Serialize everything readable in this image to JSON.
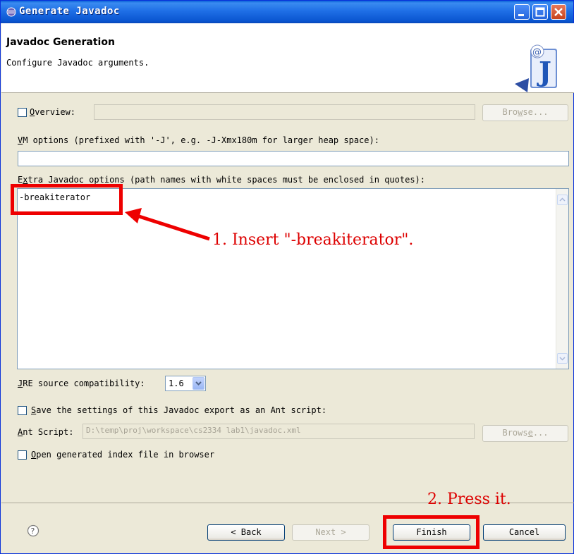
{
  "window": {
    "title": "Generate Javadoc",
    "controls": {
      "minimize": "minimize",
      "maximize": "maximize",
      "close": "close"
    }
  },
  "banner": {
    "title": "Javadoc Generation",
    "description": "Configure Javadoc arguments.",
    "icon": "javadoc-wizard-icon"
  },
  "overview": {
    "label": "Overview:",
    "mnemonic": "O",
    "value": "",
    "browse_label": "Browse...",
    "browse_mnemonic": "w"
  },
  "vm_options": {
    "label": "VM options (prefixed with '-J', e.g. -J-Xmx180m for larger heap space):",
    "mnemonic": "V",
    "value": ""
  },
  "extra_options": {
    "label": "Extra Javadoc options (path names with white spaces must be enclosed in quotes):",
    "mnemonic": "x",
    "value": "-breakiterator"
  },
  "jre": {
    "label": "JRE source compatibility:",
    "mnemonic": "J",
    "selected": "1.6"
  },
  "ant": {
    "save_label": "Save the settings of this Javadoc export as an Ant script:",
    "save_mnemonic": "S",
    "script_label": "Ant Script:",
    "script_mnemonic": "A",
    "script_value": "D:\\temp\\proj\\workspace\\cs2334 lab1\\javadoc.xml",
    "browse_label": "Browse...",
    "browse_mnemonic": "e"
  },
  "open_index": {
    "label": "Open generated index file in browser",
    "mnemonic": "O"
  },
  "footer": {
    "back_label": "< Back",
    "next_label": "Next >",
    "finish_label": "Finish",
    "cancel_label": "Cancel"
  },
  "annotations": {
    "step1": "1. Insert \"-breakiterator\".",
    "step2": "2. Press it.",
    "color": "#ee0000"
  },
  "colors": {
    "titlebar": "#0a55d0",
    "dialog_bg": "#ece9d8",
    "field_border": "#7f9db9"
  }
}
